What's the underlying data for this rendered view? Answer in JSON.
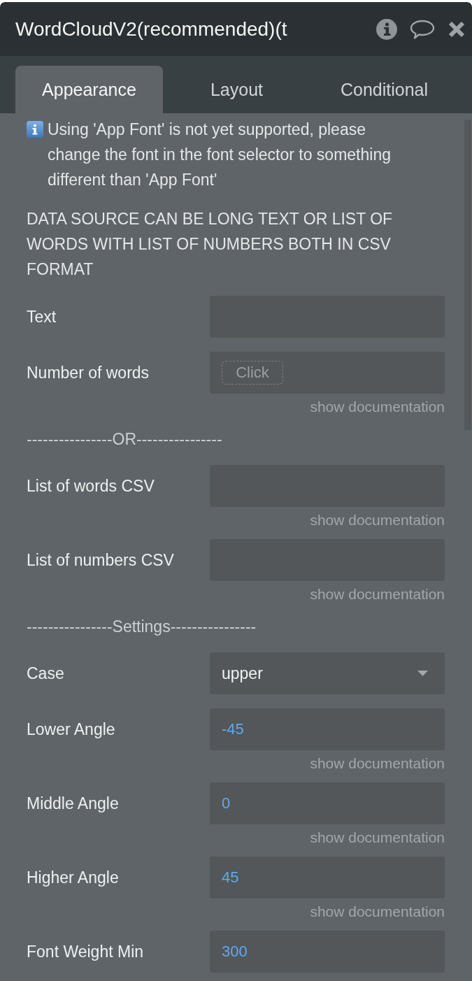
{
  "window": {
    "title": "WordCloudV2(recommended)(t"
  },
  "tabs": [
    {
      "label": "Appearance",
      "selected": true
    },
    {
      "label": "Layout",
      "selected": false
    },
    {
      "label": "Conditional",
      "selected": false
    }
  ],
  "notes": [
    {
      "kind": "info",
      "text": "Using 'App Font' is not yet supported, please change the font in the font selector to something different than 'App Font'"
    },
    {
      "kind": "plain",
      "text": "DATA SOURCE CAN BE LONG TEXT OR LIST OF WORDS WITH LIST OF NUMBERS BOTH IN CSV FORMAT"
    }
  ],
  "rows": [
    {
      "kind": "input",
      "label": "Text"
    },
    {
      "kind": "input",
      "label": "Number of words",
      "chip": "Click",
      "doc_link": "show documentation"
    },
    {
      "kind": "divider",
      "text": "----------------OR----------------"
    },
    {
      "kind": "input",
      "label": "List of words CSV",
      "doc_link": "show documentation"
    },
    {
      "kind": "input",
      "label": "List of numbers CSV",
      "doc_link": "show documentation"
    },
    {
      "kind": "divider",
      "text": "----------------Settings----------------"
    },
    {
      "kind": "dropdown",
      "label": "Case",
      "value": "upper"
    },
    {
      "kind": "input",
      "label": "Lower Angle",
      "value": "-45",
      "doc_link": "show documentation"
    },
    {
      "kind": "input",
      "label": "Middle Angle",
      "value": "0",
      "doc_link": "show documentation"
    },
    {
      "kind": "input",
      "label": "Higher Angle",
      "value": "45",
      "doc_link": "show documentation"
    },
    {
      "kind": "input",
      "label": "Font Weight Min",
      "value": "300"
    }
  ]
}
